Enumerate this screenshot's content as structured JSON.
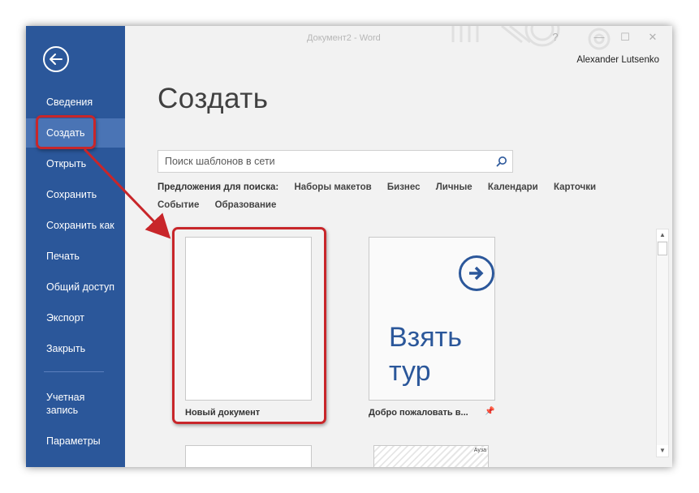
{
  "window": {
    "title": "Документ2 - Word",
    "user": "Alexander Lutsenko",
    "controls": [
      "?",
      "—",
      "☐",
      "✕"
    ]
  },
  "sidebar": {
    "items": [
      {
        "label": "Сведения"
      },
      {
        "label": "Создать",
        "active": true
      },
      {
        "label": "Открыть"
      },
      {
        "label": "Сохранить"
      },
      {
        "label": "Сохранить как"
      },
      {
        "label": "Печать"
      },
      {
        "label": "Общий доступ"
      },
      {
        "label": "Экспорт"
      },
      {
        "label": "Закрыть"
      },
      {
        "label": "Учетная\nзапись"
      },
      {
        "label": "Параметры"
      }
    ],
    "account_line1": "Учетная",
    "account_line2": "запись"
  },
  "main": {
    "title": "Создать",
    "search": {
      "placeholder": "Поиск шаблонов в сети",
      "value": ""
    },
    "suggestions": {
      "label": "Предложения для поиска:",
      "items": [
        "Наборы макетов",
        "Бизнес",
        "Личные",
        "Календари",
        "Карточки",
        "Событие",
        "Образование"
      ]
    },
    "templates": [
      {
        "label": "Новый документ"
      },
      {
        "label": "Добро пожаловать в...",
        "thumb_line1": "Взять",
        "thumb_line2": "тур"
      }
    ],
    "partial_template_label": "Ауза"
  },
  "colors": {
    "sidebar": "#2b579a",
    "sidebar_active": "#4a74b5",
    "highlight": "#c8262a",
    "accent": "#2b579a"
  },
  "icons": {
    "back": "back-arrow-icon",
    "search": "search-icon",
    "tour": "arrow-right-circle-icon",
    "pin": "pin-icon"
  }
}
